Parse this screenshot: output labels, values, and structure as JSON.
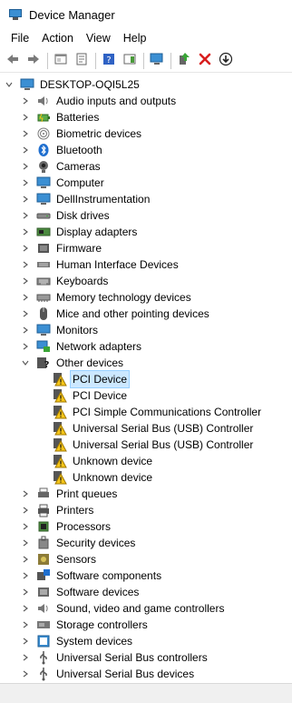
{
  "window": {
    "title": "Device Manager"
  },
  "menu": [
    "File",
    "Action",
    "View",
    "Help"
  ],
  "toolbar": [
    {
      "name": "back-icon"
    },
    {
      "name": "forward-icon"
    },
    {
      "sep": true
    },
    {
      "name": "show-hide-tree-icon"
    },
    {
      "name": "properties-icon"
    },
    {
      "sep": true
    },
    {
      "name": "help-icon"
    },
    {
      "name": "action-pane-icon"
    },
    {
      "sep": true
    },
    {
      "name": "scan-hardware-icon"
    },
    {
      "sep": true
    },
    {
      "name": "update-driver-icon"
    },
    {
      "name": "uninstall-device-icon"
    },
    {
      "name": "disable-device-icon"
    }
  ],
  "tree": {
    "root": "DESKTOP-OQI5L25",
    "categories": [
      {
        "label": "Audio inputs and outputs",
        "icon": "speaker-icon",
        "expanded": false
      },
      {
        "label": "Batteries",
        "icon": "battery-icon",
        "expanded": false
      },
      {
        "label": "Biometric devices",
        "icon": "fingerprint-icon",
        "expanded": false
      },
      {
        "label": "Bluetooth",
        "icon": "bluetooth-icon",
        "expanded": false
      },
      {
        "label": "Cameras",
        "icon": "camera-icon",
        "expanded": false
      },
      {
        "label": "Computer",
        "icon": "computer-icon",
        "expanded": false
      },
      {
        "label": "DellInstrumentation",
        "icon": "monitor-icon",
        "expanded": false
      },
      {
        "label": "Disk drives",
        "icon": "disk-drive-icon",
        "expanded": false
      },
      {
        "label": "Display adapters",
        "icon": "display-adapter-icon",
        "expanded": false
      },
      {
        "label": "Firmware",
        "icon": "firmware-icon",
        "expanded": false
      },
      {
        "label": "Human Interface Devices",
        "icon": "hid-icon",
        "expanded": false
      },
      {
        "label": "Keyboards",
        "icon": "keyboard-icon",
        "expanded": false
      },
      {
        "label": "Memory technology devices",
        "icon": "memory-icon",
        "expanded": false
      },
      {
        "label": "Mice and other pointing devices",
        "icon": "mouse-icon",
        "expanded": false
      },
      {
        "label": "Monitors",
        "icon": "monitor-icon",
        "expanded": false
      },
      {
        "label": "Network adapters",
        "icon": "network-adapter-icon",
        "expanded": false
      },
      {
        "label": "Other devices",
        "icon": "other-devices-icon",
        "expanded": true,
        "children": [
          {
            "label": "PCI Device",
            "selected": true
          },
          {
            "label": "PCI Device"
          },
          {
            "label": "PCI Simple Communications Controller"
          },
          {
            "label": "Universal Serial Bus (USB) Controller"
          },
          {
            "label": "Universal Serial Bus (USB) Controller"
          },
          {
            "label": "Unknown device"
          },
          {
            "label": "Unknown device"
          }
        ]
      },
      {
        "label": "Print queues",
        "icon": "print-queue-icon",
        "expanded": false
      },
      {
        "label": "Printers",
        "icon": "printer-icon",
        "expanded": false
      },
      {
        "label": "Processors",
        "icon": "processor-icon",
        "expanded": false
      },
      {
        "label": "Security devices",
        "icon": "security-device-icon",
        "expanded": false
      },
      {
        "label": "Sensors",
        "icon": "sensor-icon",
        "expanded": false
      },
      {
        "label": "Software components",
        "icon": "software-component-icon",
        "expanded": false
      },
      {
        "label": "Software devices",
        "icon": "software-device-icon",
        "expanded": false
      },
      {
        "label": "Sound, video and game controllers",
        "icon": "sound-controller-icon",
        "expanded": false
      },
      {
        "label": "Storage controllers",
        "icon": "storage-controller-icon",
        "expanded": false
      },
      {
        "label": "System devices",
        "icon": "system-device-icon",
        "expanded": false
      },
      {
        "label": "Universal Serial Bus controllers",
        "icon": "usb-icon",
        "expanded": false
      },
      {
        "label": "Universal Serial Bus devices",
        "icon": "usb-icon",
        "expanded": false
      }
    ]
  },
  "colors": {
    "selection": "#cce8ff",
    "warning": "#f5c518",
    "accent": "#3b8fd3"
  }
}
